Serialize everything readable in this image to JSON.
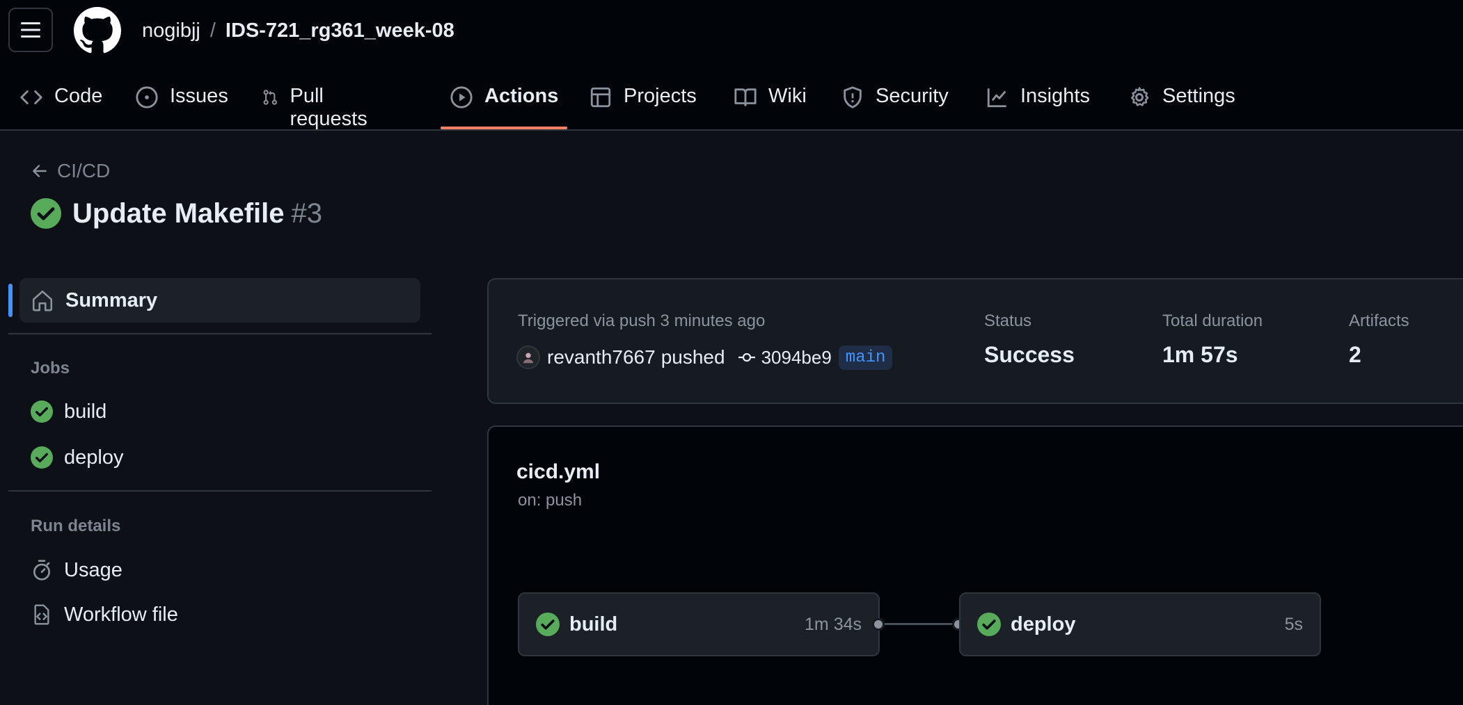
{
  "repo": {
    "owner": "nogibjj",
    "separator": "/",
    "name": "IDS-721_rg361_week-08"
  },
  "tabs": [
    {
      "label": "Code",
      "icon": "code-icon"
    },
    {
      "label": "Issues",
      "icon": "issue-icon"
    },
    {
      "label": "Pull requests",
      "icon": "pull-request-icon"
    },
    {
      "label": "Actions",
      "icon": "play-icon",
      "active": true
    },
    {
      "label": "Projects",
      "icon": "table-icon"
    },
    {
      "label": "Wiki",
      "icon": "book-icon"
    },
    {
      "label": "Security",
      "icon": "shield-icon"
    },
    {
      "label": "Insights",
      "icon": "graph-icon"
    },
    {
      "label": "Settings",
      "icon": "gear-icon"
    }
  ],
  "run": {
    "back_label": "CI/CD",
    "title": "Update Makefile",
    "number": "#3"
  },
  "sidebar": {
    "summary_label": "Summary",
    "jobs_heading": "Jobs",
    "jobs": [
      "build",
      "deploy"
    ],
    "run_details_heading": "Run details",
    "details": [
      {
        "label": "Usage",
        "icon": "stopwatch-icon"
      },
      {
        "label": "Workflow file",
        "icon": "file-code-icon"
      }
    ]
  },
  "summary": {
    "trigger_text": "Triggered via push 3 minutes ago",
    "actor": "revanth7667",
    "action": "pushed",
    "commit": "3094be9",
    "branch": "main",
    "status_label": "Status",
    "status_value": "Success",
    "duration_label": "Total duration",
    "duration_value": "1m 57s",
    "artifacts_label": "Artifacts",
    "artifacts_value": "2"
  },
  "workflow": {
    "file": "cicd.yml",
    "trigger": "on: push",
    "jobs": [
      {
        "name": "build",
        "duration": "1m 34s"
      },
      {
        "name": "deploy",
        "duration": "5s"
      }
    ]
  },
  "colors": {
    "success": "#3fb950",
    "accent_underline": "#f78166",
    "link": "#4493f8"
  }
}
